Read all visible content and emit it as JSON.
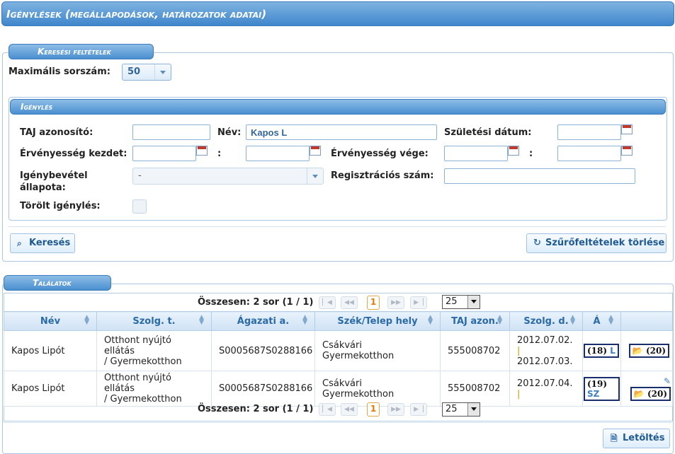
{
  "page": {
    "title": "Igénylések (megállapodások, határozatok adatai)"
  },
  "search": {
    "legend": "Keresési feltételek",
    "max_label": "Maximális sorszám:",
    "max_value": "50",
    "section_legend": "Igénylés",
    "taj_label": "TAJ azonosító:",
    "taj_value": "",
    "name_label": "Név:",
    "name_value": "Kapos L",
    "birth_label": "Születési dátum:",
    "validity_start_label": "Érvényesség kezdet:",
    "range_sep": ":",
    "validity_end_label": "Érvényesség vége:",
    "status_label_1": "Igénybevétel",
    "status_label_2": "állapota:",
    "status_value": "-",
    "reg_label": "Regisztrációs szám:",
    "deleted_label": "Törölt igénylés:",
    "search_button": "Keresés",
    "clear_button": "Szűrőfeltételek törlése"
  },
  "results": {
    "legend": "Találatok",
    "summary": "Összesen: 2 sor (1 / 1)",
    "current_page": "1",
    "page_size": "25",
    "columns": [
      "Név",
      "Szolg. t.",
      "Ágazati a.",
      "Szék/Telep hely",
      "TAJ azon.",
      "Szolg. d.",
      "Á"
    ],
    "rows": [
      {
        "name": "Kapos Lipót",
        "service_1": "Otthont nyújtó ellátás",
        "service_2": "/ Gyermekotthon",
        "sector": "S0005687S0288166",
        "seat_1": "Csákvári",
        "seat_2": "Gyermekotthon",
        "taj": "555008702",
        "date_from": "2012.07.02.",
        "date_sep": "|",
        "date_to": "2012.07.03.",
        "state_num": "(18)",
        "state_code": "L",
        "action_num": "(20)"
      },
      {
        "name": "Kapos Lipót",
        "service_1": "Otthont nyújtó ellátás",
        "service_2": "/ Gyermekotthon",
        "sector": "S0005687S0288166",
        "seat_1": "Csákvári",
        "seat_2": "Gyermekotthon",
        "taj": "555008702",
        "date_from": "2012.07.04.",
        "date_sep": "|",
        "date_to": "",
        "state_num": "(19)",
        "state_code": "SZ",
        "action_num": "(20)"
      }
    ],
    "download_button": "Letöltés"
  }
}
